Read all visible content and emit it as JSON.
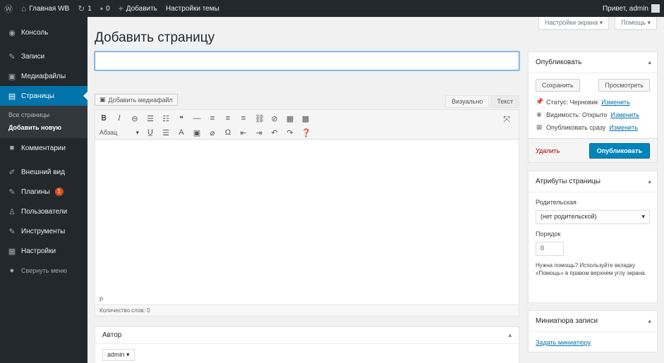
{
  "adminbar": {
    "wp_icon": "wordpress-logo-icon",
    "site_name": "Главная WB",
    "comments_count": "1",
    "updates_count": "",
    "new_label": "Добавить",
    "customize_label": "Настройки темы",
    "greeting": "Привет, admin"
  },
  "sidebar": {
    "items": [
      {
        "label": "Консоль",
        "icon": "dashboard-icon",
        "glyph": "◉"
      },
      {
        "label": "Записи",
        "icon": "pin-icon",
        "glyph": "✎"
      },
      {
        "label": "Медиафайлы",
        "icon": "media-icon",
        "glyph": "▣"
      },
      {
        "label": "Страницы",
        "icon": "pages-icon",
        "glyph": "▤"
      },
      {
        "label": "Комментарии",
        "icon": "comments-icon",
        "glyph": "■"
      },
      {
        "label": "Внешний вид",
        "icon": "appearance-icon",
        "glyph": "✐"
      },
      {
        "label": "Плагины",
        "icon": "plugins-icon",
        "glyph": "✎",
        "badge": "1"
      },
      {
        "label": "Пользователи",
        "icon": "users-icon",
        "glyph": "♙"
      },
      {
        "label": "Инструменты",
        "icon": "tools-icon",
        "glyph": "✎"
      },
      {
        "label": "Настройки",
        "icon": "settings-icon",
        "glyph": "▦"
      },
      {
        "label": "Свернуть меню",
        "icon": "collapse-icon",
        "glyph": "●"
      }
    ],
    "submenu": {
      "all_pages": "Все страницы",
      "add_new": "Добавить новую"
    }
  },
  "screen_meta": {
    "screen_options": "Настройки экрана ▾",
    "help": "Помощь ▾"
  },
  "main": {
    "title": "Добавить страницу",
    "title_placeholder": "",
    "add_media": "Добавить медиафайл",
    "tab_visual": "Визуально",
    "tab_text": "Текст",
    "format_select": "Абзац",
    "path": "p",
    "word_count": "Количество слов: 0"
  },
  "author_box": {
    "title": "Автор",
    "selected": "admin ▾"
  },
  "publish_box": {
    "title": "Опубликовать",
    "save_draft": "Сохранить",
    "preview": "Просмотреть",
    "status_label": "Статус: Черновик",
    "status_edit": "Изменить",
    "visibility_label": "Видимость: Открыто",
    "visibility_edit": "Изменить",
    "schedule_label": "Опубликовать сразу",
    "schedule_edit": "Изменить",
    "delete": "Удалить",
    "publish": "Опубликовать"
  },
  "attributes_box": {
    "title": "Атрибуты страницы",
    "parent_label": "Родительская",
    "parent_value": "(нет родительской)",
    "order_label": "Порядок",
    "order_value": "0",
    "help": "Нужна помощь? Используйте вкладку «Помощь» в правом верхнем углу экрана."
  },
  "thumbnail_box": {
    "title": "Миниатюра записи",
    "set_link": "Задать миниатюру"
  },
  "colors": {
    "admin_dark": "#23282d",
    "accent_blue": "#0073aa",
    "publish_blue": "#0085ba",
    "delete_red": "#a00",
    "badge_orange": "#d54e21"
  }
}
